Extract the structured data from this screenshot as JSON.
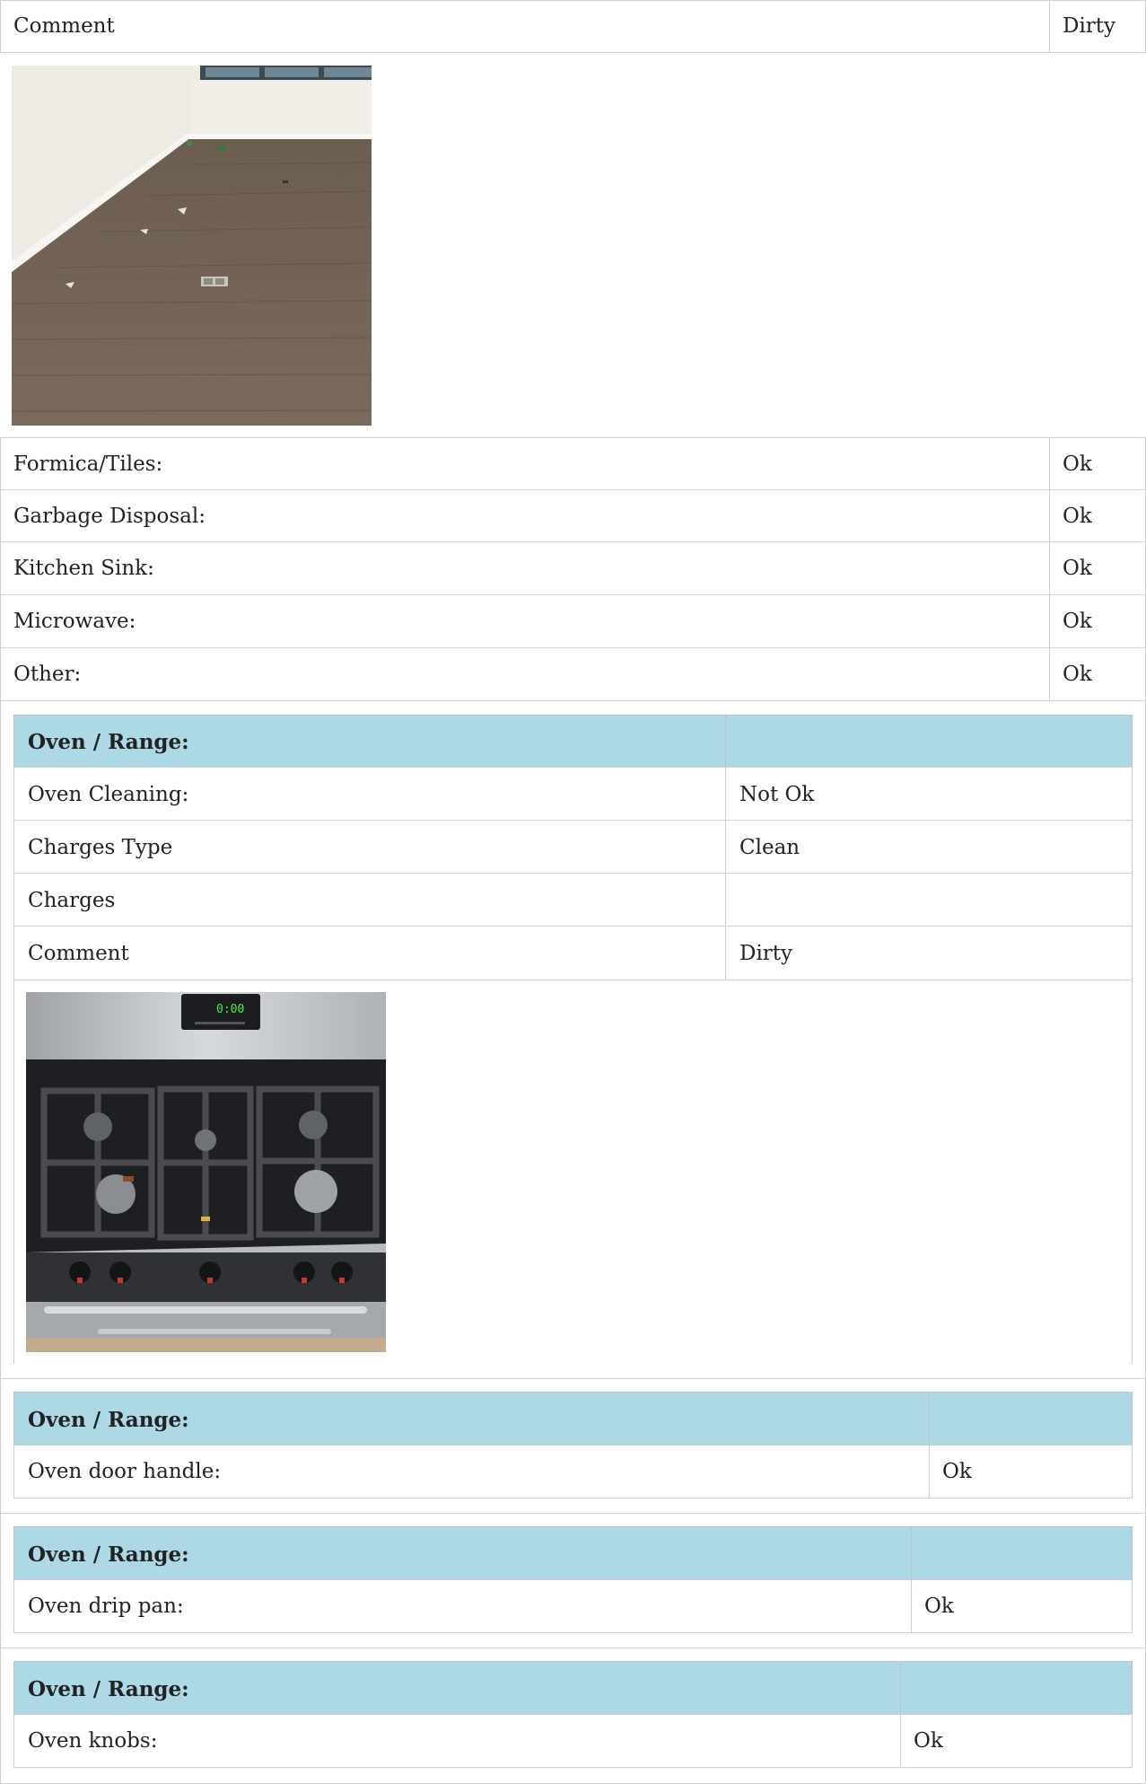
{
  "top_comment": {
    "label": "Comment",
    "value": "Dirty"
  },
  "items": [
    {
      "label": "Formica/Tiles:",
      "value": "Ok"
    },
    {
      "label": "Garbage Disposal:",
      "value": "Ok"
    },
    {
      "label": "Kitchen Sink:",
      "value": "Ok"
    },
    {
      "label": "Microwave:",
      "value": "Ok"
    },
    {
      "label": "Other:",
      "value": "Ok"
    }
  ],
  "oven_sections": [
    {
      "title": "Oven / Range:",
      "rows": [
        {
          "label": "Oven Cleaning:",
          "value": "Not Ok"
        },
        {
          "label": "Charges Type",
          "value": "Clean"
        },
        {
          "label": "Charges",
          "value": ""
        },
        {
          "label": "Comment",
          "value": "Dirty"
        }
      ]
    },
    {
      "title": "Oven / Range:",
      "rows": [
        {
          "label": "Oven door handle:",
          "value": "Ok"
        }
      ]
    },
    {
      "title": "Oven / Range:",
      "rows": [
        {
          "label": "Oven drip pan:",
          "value": "Ok"
        }
      ]
    },
    {
      "title": "Oven / Range:",
      "rows": [
        {
          "label": "Oven knobs:",
          "value": "Ok"
        }
      ]
    }
  ],
  "images": [
    {
      "name": "floor-photo"
    },
    {
      "name": "stove-photo",
      "display_readout": "0:00"
    }
  ]
}
